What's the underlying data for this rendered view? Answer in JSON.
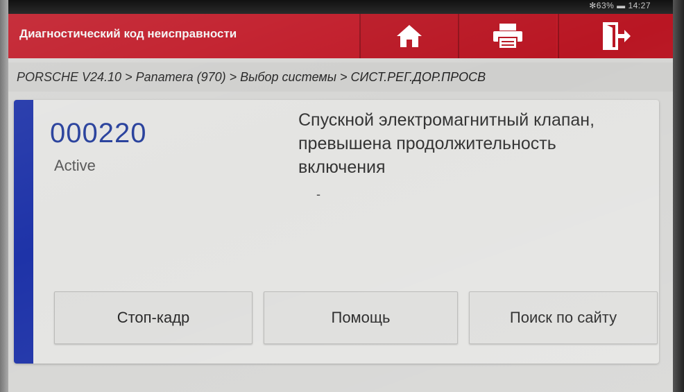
{
  "status_bar": {
    "text": "✻63% ▬ 14:27"
  },
  "header": {
    "title": "Диагностический код неисправности",
    "buttons": [
      {
        "name": "home",
        "icon": "home-icon"
      },
      {
        "name": "print",
        "icon": "printer-icon"
      },
      {
        "name": "exit",
        "icon": "exit-icon"
      }
    ]
  },
  "breadcrumb": "PORSCHE V24.10 > Panamera (970) > Выбор системы > СИСТ.РЕГ.ДОР.ПРОСВ",
  "dtc": {
    "code": "000220",
    "status": "Active",
    "description": "Спускной электромагнитный клапан, превышена продолжительность включения",
    "extra": "-"
  },
  "actions": {
    "freeze_frame": "Стоп-кадр",
    "help": "Помощь",
    "web_search": "Поиск по сайту"
  },
  "colors": {
    "header": "#c01826",
    "accent": "#1e33a8",
    "code": "#243d9a"
  }
}
